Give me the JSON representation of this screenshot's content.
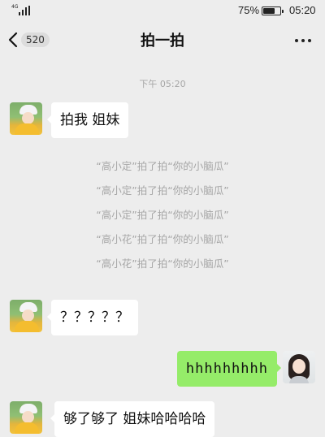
{
  "status_bar": {
    "network": "4G",
    "battery_percent": "75%",
    "battery_level": 0.75,
    "time": "05:20"
  },
  "header": {
    "back_badge": "520",
    "title": "拍一拍",
    "more_icon": "more-dots-icon"
  },
  "chat": {
    "timestamp": "下午 05:20",
    "messages": [
      {
        "text": "拍我 姐妹"
      },
      {
        "text": "？？？？？"
      },
      {
        "text": "hhhhhhhhh"
      },
      {
        "text": "够了够了 姐妹哈哈哈哈"
      }
    ],
    "system_messages": [
      "“高小定”拍了拍“你的小脑瓜”",
      "“高小定”拍了拍“你的小脑瓜”",
      "“高小定”拍了拍“你的小脑瓜”",
      "“高小花”拍了拍“你的小脑瓜”",
      "“高小花”拍了拍“你的小脑瓜”"
    ]
  },
  "colors": {
    "background": "#ededed",
    "own_bubble": "#95ec69",
    "other_bubble": "#ffffff",
    "system_text": "#a6a6a6"
  }
}
